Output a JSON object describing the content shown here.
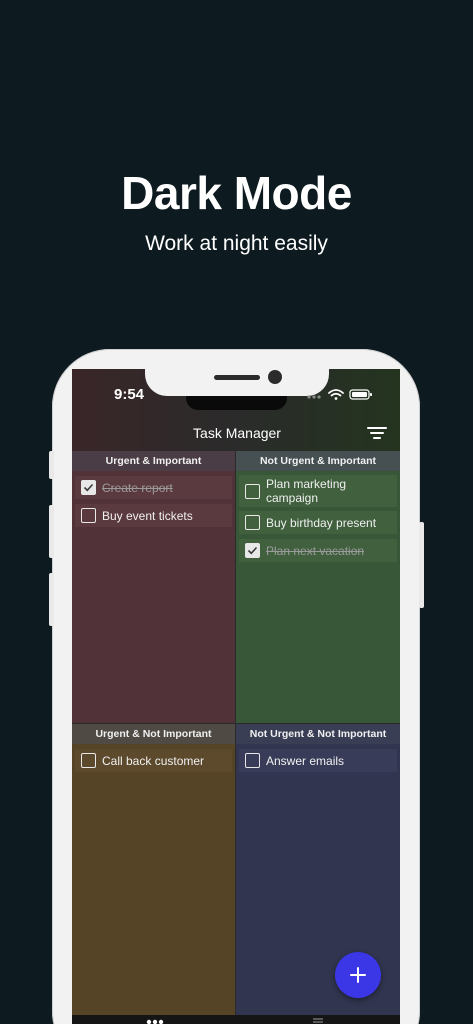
{
  "hero": {
    "title": "Dark Mode",
    "subtitle": "Work at night easily"
  },
  "status_bar": {
    "time": "9:54",
    "icons": [
      "signal-dots-icon",
      "wifi-icon",
      "battery-icon"
    ]
  },
  "app": {
    "title": "Task Manager",
    "filter_icon": "filter-icon"
  },
  "quadrants": [
    {
      "header": "Urgent & Important",
      "color": "#513238",
      "tasks": [
        {
          "label": "Create report",
          "done": true
        },
        {
          "label": "Buy event tickets",
          "done": false
        }
      ]
    },
    {
      "header": "Not Urgent & Important",
      "color": "#385638",
      "tasks": [
        {
          "label": "Plan marketing campaign",
          "done": false
        },
        {
          "label": "Buy birthday present",
          "done": false
        },
        {
          "label": "Plan next vacation",
          "done": true
        }
      ]
    },
    {
      "header": "Urgent & Not Important",
      "color": "#554426",
      "tasks": [
        {
          "label": "Call back customer",
          "done": false
        }
      ]
    },
    {
      "header": "Not Urgent & Not Important",
      "color": "#31354f",
      "tasks": [
        {
          "label": "Answer emails",
          "done": false
        }
      ]
    }
  ],
  "fab": {
    "icon": "plus-icon",
    "color": "#3b36e6"
  },
  "colors": {
    "background": "#0d1a20"
  }
}
